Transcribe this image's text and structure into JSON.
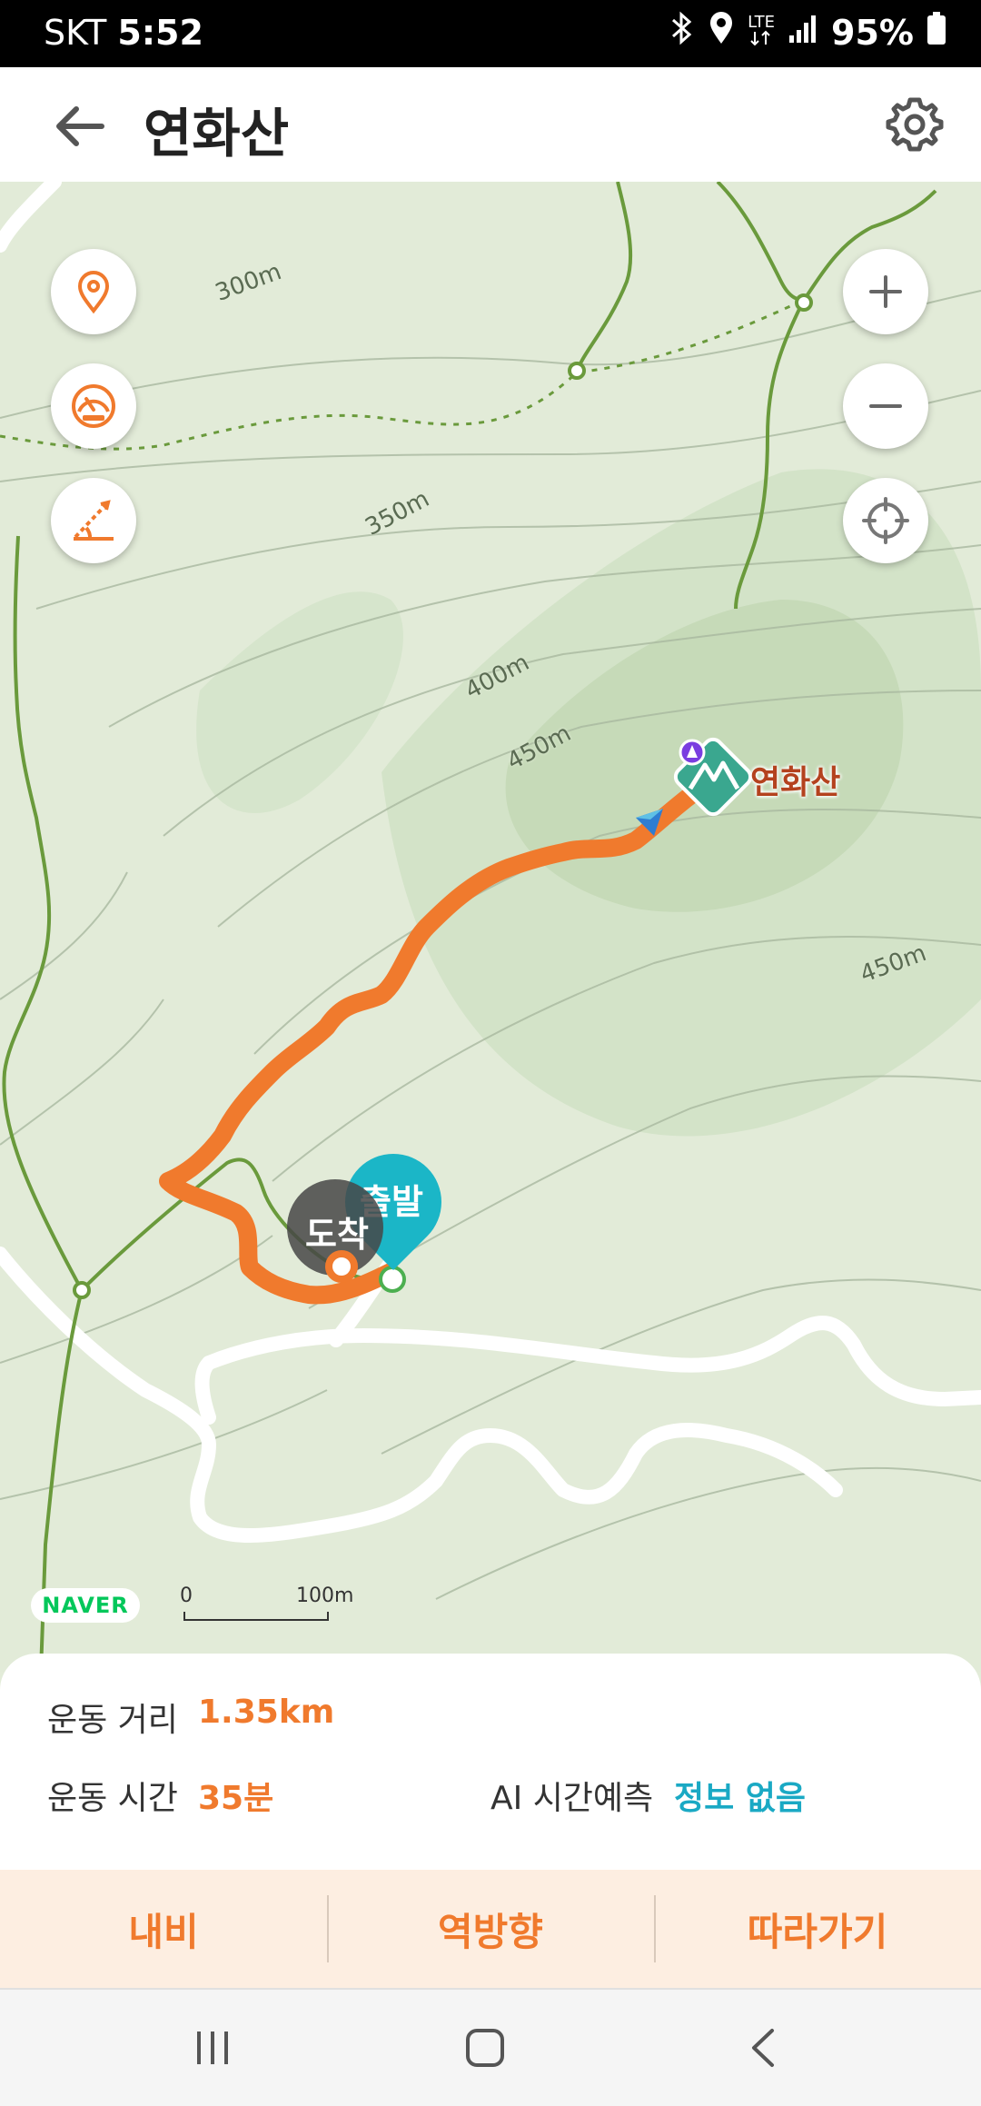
{
  "status_bar": {
    "carrier": "SKT",
    "time": "5:52",
    "network": "LTE",
    "battery": "95%",
    "icons": [
      "bluetooth-icon",
      "location-icon",
      "lte-icon",
      "signal-icon",
      "battery-icon"
    ]
  },
  "header": {
    "title": "연화산",
    "back_icon": "back-arrow-icon",
    "settings_icon": "gear-icon"
  },
  "map": {
    "peak_name": "연화산",
    "contour_labels": [
      "300m",
      "350m",
      "400m",
      "450m",
      "450m"
    ],
    "start_marker": "출발",
    "end_marker": "도착",
    "provider": "NAVER",
    "scale": {
      "start": "0",
      "end": "100m"
    },
    "left_controls": [
      "location-pin-icon",
      "speedometer-icon",
      "slope-icon"
    ],
    "right_controls": [
      "zoom-in-icon",
      "zoom-out-icon",
      "crosshair-icon"
    ],
    "colors": {
      "route": "#f07a2d",
      "trail": "#6a9a3c",
      "start": "#1bb6c7",
      "peak": "#b4421e"
    }
  },
  "stats": {
    "distance_label": "운동 거리",
    "distance_value": "1.35km",
    "time_label": "운동 시간",
    "time_value": "35분",
    "ai_label": "AI 시간예측",
    "ai_value": "정보 없음"
  },
  "actions": {
    "navi": "내비",
    "reverse": "역방향",
    "follow": "따라가기"
  },
  "navbar": [
    "recent-apps-icon",
    "home-icon",
    "back-icon"
  ]
}
